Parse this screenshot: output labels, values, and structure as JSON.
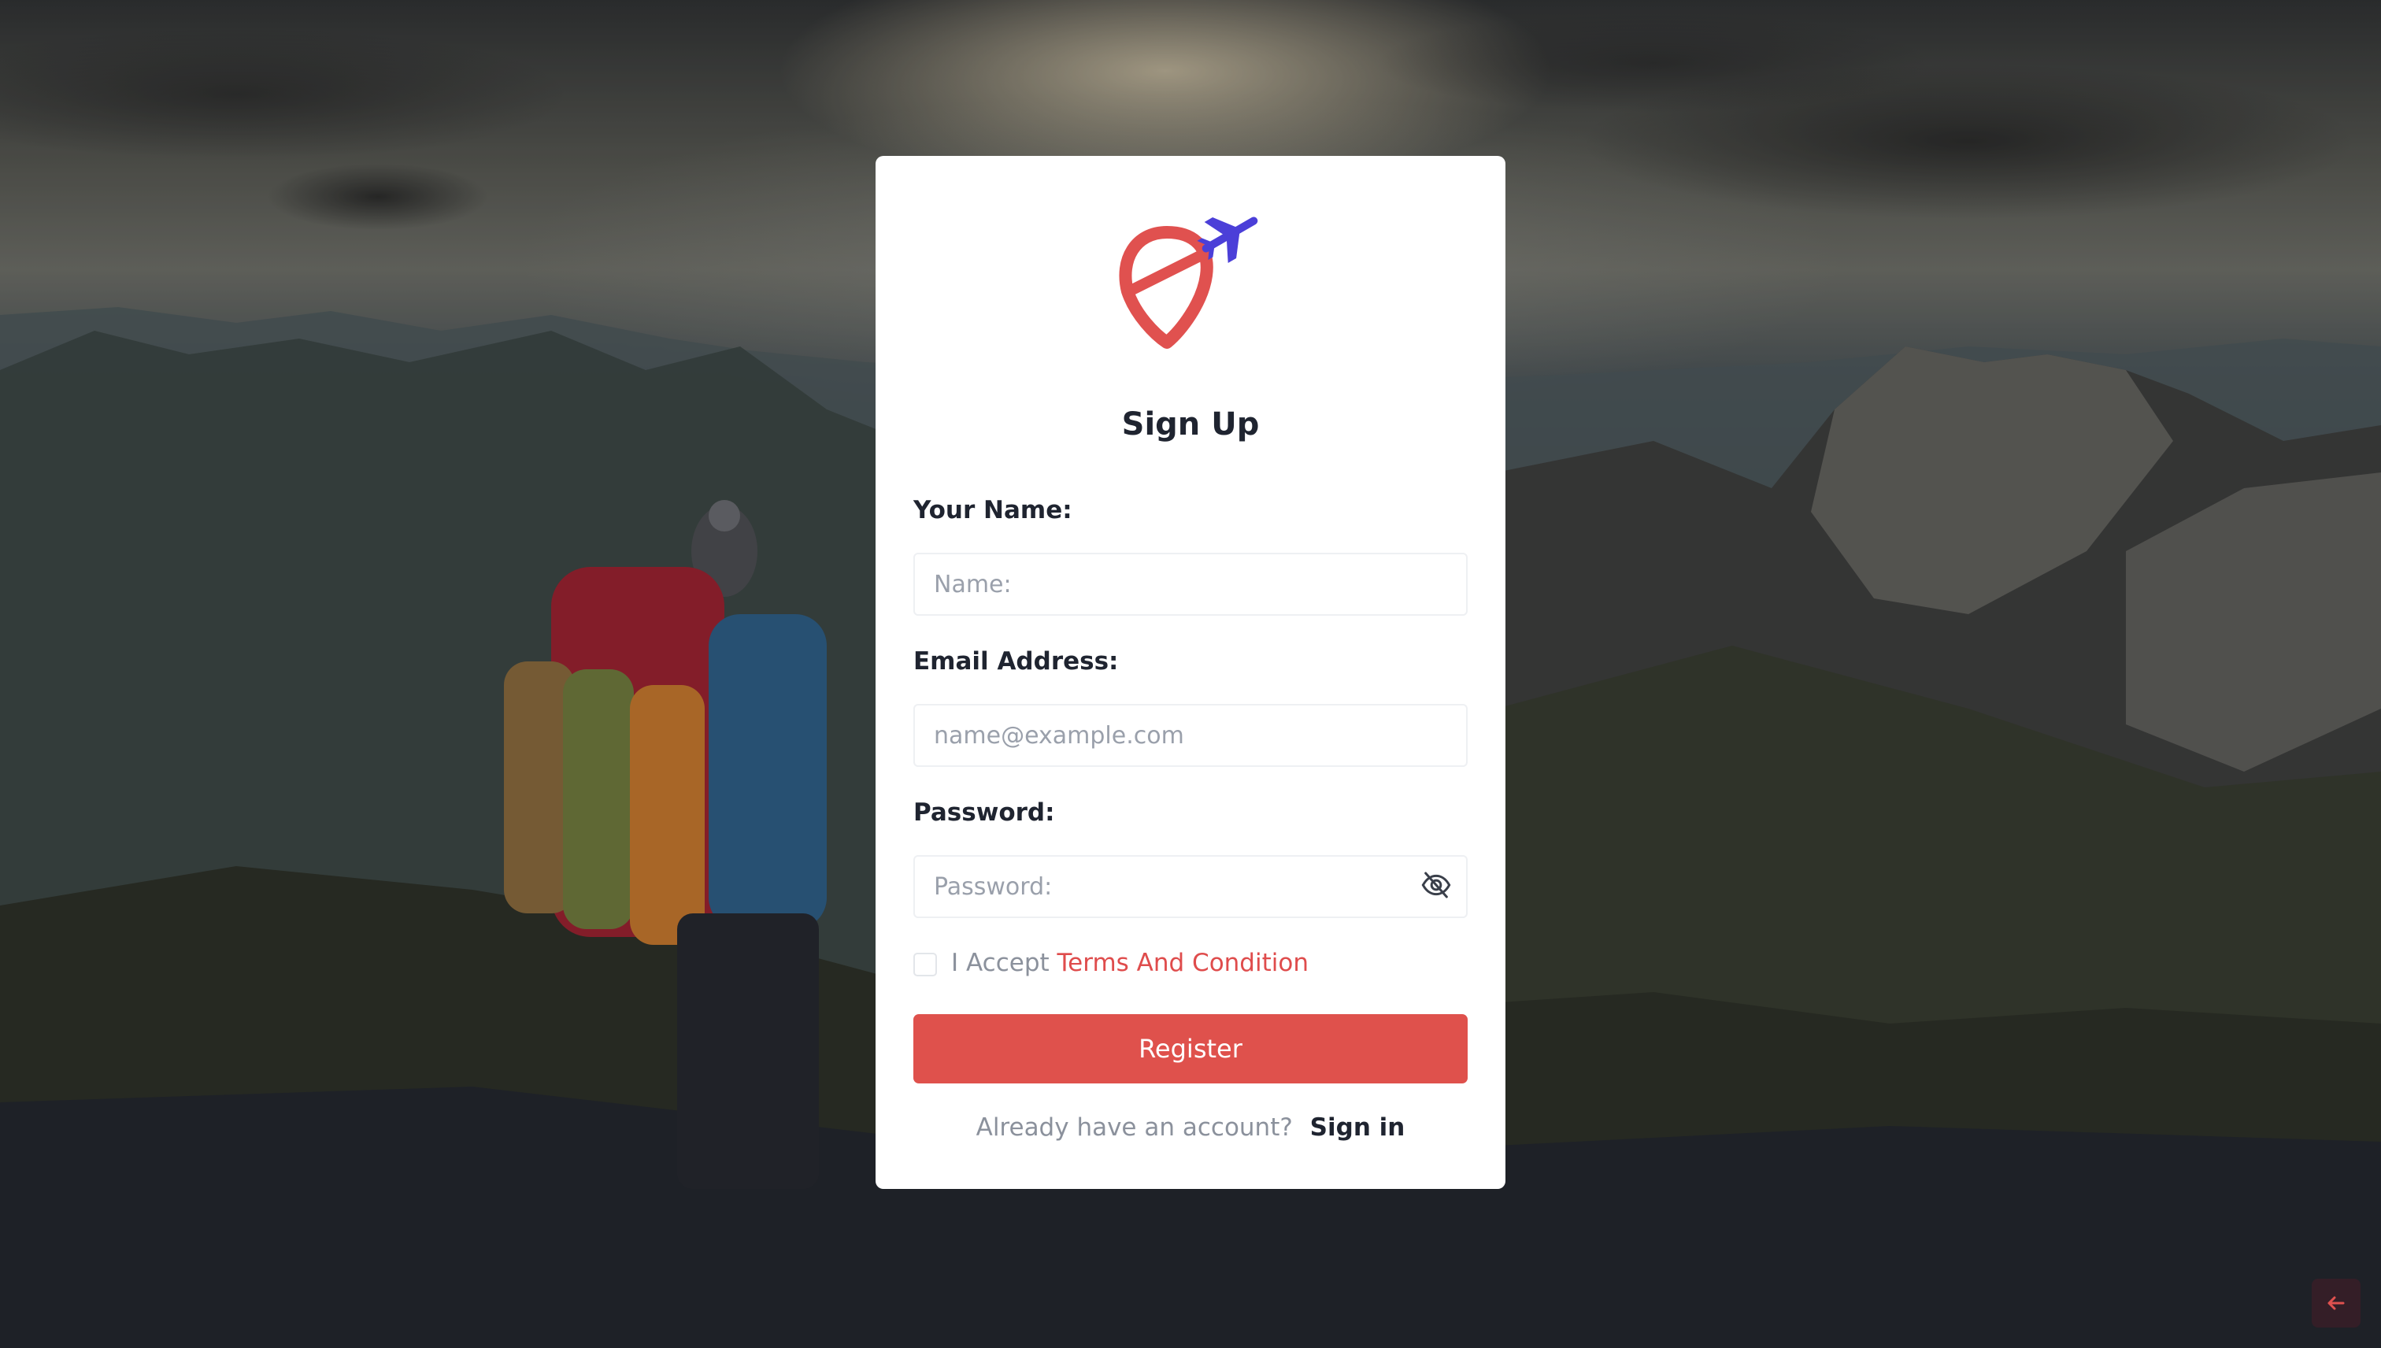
{
  "form": {
    "title": "Sign Up",
    "name_label": "Your Name:",
    "name_placeholder": "Name:",
    "email_label": "Email Address:",
    "email_placeholder": "name@example.com",
    "password_label": "Password:",
    "password_placeholder": "Password:",
    "accept_prefix": "I Accept",
    "terms_link": "Terms And Condition",
    "register_label": "Register",
    "have_account_text": "Already have an account?",
    "signin_link": "Sign in"
  },
  "icons": {
    "logo": "travel-pin-plane-logo",
    "password_toggle": "eye-off-icon",
    "back": "arrow-left-icon"
  },
  "colors": {
    "accent": "#df514c",
    "logo_pin": "#e0514f",
    "logo_plane": "#4b3fd8",
    "text_dark": "#1f2430",
    "text_muted": "#8b919c"
  }
}
